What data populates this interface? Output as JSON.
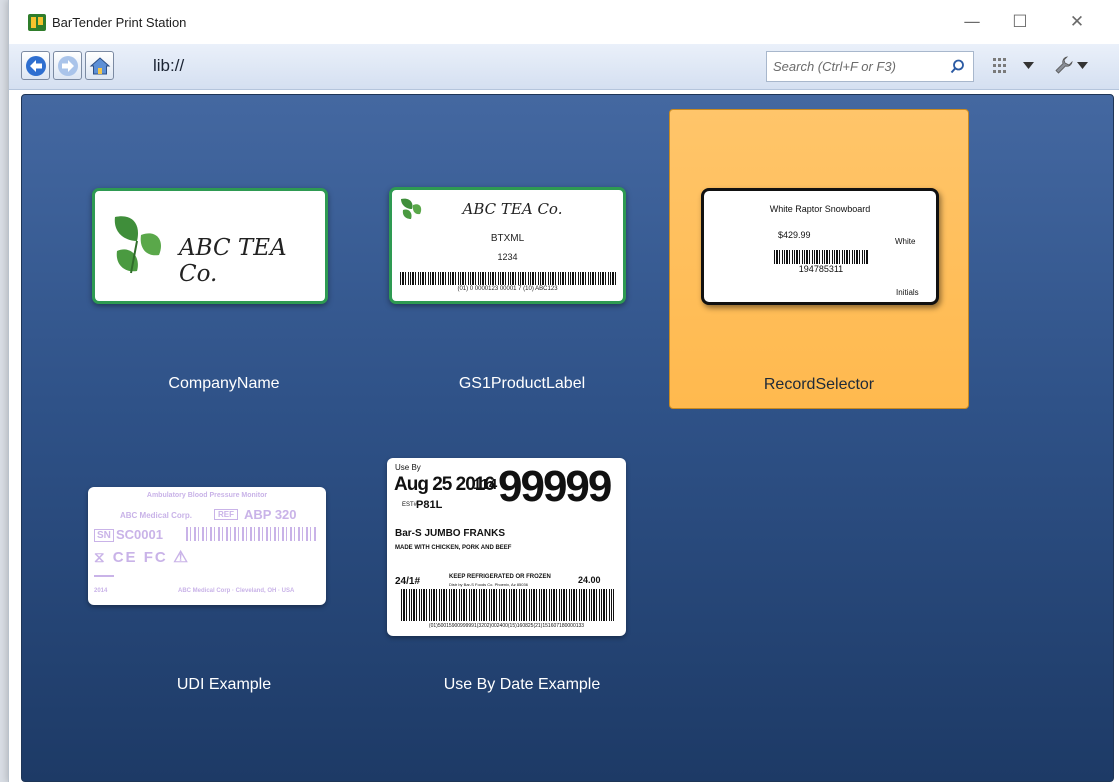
{
  "window": {
    "title": "BarTender Print Station",
    "controls": [
      "—",
      "☐",
      "✕"
    ]
  },
  "toolbar": {
    "path": "lib://",
    "search_placeholder": "Search (Ctrl+F or F3)"
  },
  "tiles": [
    {
      "label": "CompanyName",
      "preview": {
        "brand": "ABC TEA Co."
      }
    },
    {
      "label": "GS1ProductLabel",
      "preview": {
        "brand": "ABC TEA Co.",
        "line1": "BTXML",
        "line2": "1234",
        "barcode_text": "(01) 0 0000123 00001 7 (10) ABC123"
      }
    },
    {
      "label": "RecordSelector",
      "selected": true,
      "preview": {
        "product": "White Raptor Snowboard",
        "price": "$429.99",
        "color": "White",
        "sku": "194785311",
        "initials": "Initials"
      }
    },
    {
      "label": "UDI Example",
      "preview": {
        "title": "Ambulatory Blood Pressure Monitor",
        "maker": "ABC Medical Corp.",
        "ref": "REF",
        "model": "ABP 320",
        "sn": "SN",
        "serial": "SC0001",
        "footer_a": "2014",
        "footer_b": "ABC Medical Corp · Cleveland, OH · USA"
      }
    },
    {
      "label": "Use By Date Example",
      "preview": {
        "use_by": "Use By",
        "date": "Aug 25 2016",
        "code": "114",
        "big_number": "99999",
        "estab": "EST#",
        "estab_no": "P81L",
        "product": "Bar-S JUMBO FRANKS",
        "ingredients": "MADE WITH CHICKEN, PORK AND BEEF",
        "count": "24/1#",
        "storage": "KEEP REFRIGERATED OR FROZEN",
        "distributor": "Distr by Bar-S Foods Co. Phoenix, Az 85036",
        "weight": "24.00",
        "barcode_text": "(01)50015900999991(3202)002400(15)160825(21)151607180000133"
      }
    }
  ],
  "colors": {
    "content_bg_top": "#4468a1",
    "content_bg_bottom": "#1d3a66",
    "selected_tile": "#ffbe5a",
    "label_border": "#2e9a52"
  }
}
